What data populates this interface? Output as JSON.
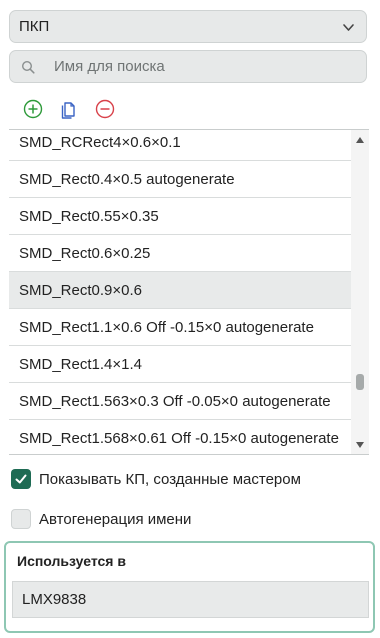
{
  "type_select": {
    "value": "ПКП"
  },
  "search": {
    "placeholder": "Имя для поиска",
    "value": ""
  },
  "toolbar": {
    "icons": [
      "add-icon",
      "copy-icon",
      "remove-icon"
    ],
    "add_color": "#2e9a3a",
    "copy_color": "#3a63c4",
    "remove_color": "#d8414a"
  },
  "list": {
    "items": [
      "SMD_RCRect4×0.6×0.1",
      "SMD_Rect0.4×0.5 autogenerate",
      "SMD_Rect0.55×0.35",
      "SMD_Rect0.6×0.25",
      "SMD_Rect0.9×0.6",
      "SMD_Rect1.1×0.6 Off -0.15×0 autogenerate",
      "SMD_Rect1.4×1.4",
      "SMD_Rect1.563×0.3 Off -0.05×0 autogenerate",
      "SMD_Rect1.568×0.61 Off -0.15×0 autogenerate"
    ],
    "selected_index": 4
  },
  "options": {
    "show_wizard_pads": {
      "label": "Показывать КП, созданные мастером",
      "checked": true
    },
    "auto_name": {
      "label": "Автогенерация имени",
      "checked": false
    }
  },
  "used_in": {
    "title": "Используется в",
    "items": [
      "LMX9838"
    ]
  },
  "colors": {
    "accent": "#1e6b54",
    "panel_border": "#8ec7b3"
  }
}
